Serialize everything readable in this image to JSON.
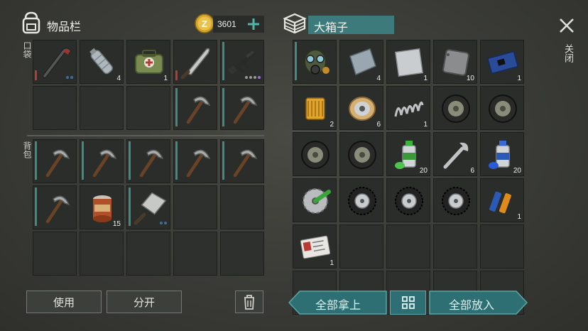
{
  "inventory": {
    "title": "物品栏",
    "coins": "3601",
    "pocket_label": "口袋",
    "backpack_label": "背包",
    "pocket_slots": [
      {
        "icon": "crowbar-icon",
        "count": "",
        "dur": "red",
        "dots": [
          "#3b6e9a",
          "#3b6e9a"
        ]
      },
      {
        "icon": "bottle-icon",
        "count": "4",
        "dur": "",
        "dots": []
      },
      {
        "icon": "medkit-bag-icon",
        "count": "1",
        "dur": "",
        "dots": []
      },
      {
        "icon": "machete-icon",
        "count": "",
        "dur": "red",
        "dots": []
      },
      {
        "icon": "rifle-icon",
        "count": "",
        "dur": "teal",
        "dots": [
          "#999",
          "#999",
          "#999",
          "#9a6bd0"
        ]
      },
      {
        "icon": "",
        "count": "",
        "dur": "",
        "dots": []
      },
      {
        "icon": "",
        "count": "",
        "dur": "",
        "dots": []
      },
      {
        "icon": "",
        "count": "",
        "dur": "",
        "dots": []
      },
      {
        "icon": "pickaxe-icon",
        "count": "",
        "dur": "teal",
        "dots": []
      },
      {
        "icon": "pickaxe-icon",
        "count": "",
        "dur": "teal",
        "dots": []
      }
    ],
    "backpack_slots": [
      {
        "icon": "pickaxe-icon",
        "count": "",
        "dur": "teal",
        "dots": []
      },
      {
        "icon": "pickaxe-icon",
        "count": "",
        "dur": "teal",
        "dots": []
      },
      {
        "icon": "pickaxe-icon",
        "count": "",
        "dur": "teal",
        "dots": []
      },
      {
        "icon": "pickaxe-icon",
        "count": "",
        "dur": "teal",
        "dots": []
      },
      {
        "icon": "pickaxe-icon",
        "count": "",
        "dur": "teal",
        "dots": []
      },
      {
        "icon": "pickaxe-icon",
        "count": "",
        "dur": "teal",
        "dots": []
      },
      {
        "icon": "can-icon",
        "count": "15",
        "dur": "",
        "dots": []
      },
      {
        "icon": "cleaver-icon",
        "count": "",
        "dur": "teal",
        "dots": [
          "#3b6e9a",
          "#3b6e9a"
        ]
      },
      {
        "icon": "",
        "count": "",
        "dur": "",
        "dots": []
      },
      {
        "icon": "",
        "count": "",
        "dur": "",
        "dots": []
      },
      {
        "icon": "",
        "count": "",
        "dur": "",
        "dots": []
      },
      {
        "icon": "",
        "count": "",
        "dur": "",
        "dots": []
      },
      {
        "icon": "",
        "count": "",
        "dur": "",
        "dots": []
      },
      {
        "icon": "",
        "count": "",
        "dur": "",
        "dots": []
      },
      {
        "icon": "",
        "count": "",
        "dur": "",
        "dots": []
      }
    ],
    "use_label": "使用",
    "split_label": "分开"
  },
  "box": {
    "title": "大箱子",
    "close_label": "关闭",
    "slots": [
      {
        "icon": "gas-mask-icon",
        "count": "",
        "dur": "teal"
      },
      {
        "icon": "metal-plate-icon",
        "count": "4",
        "dur": ""
      },
      {
        "icon": "steel-sheet-icon",
        "count": "1",
        "dur": ""
      },
      {
        "icon": "iron-plate-icon",
        "count": "10",
        "dur": ""
      },
      {
        "icon": "circuit-board-icon",
        "count": "1",
        "dur": ""
      },
      {
        "icon": "oil-filter-icon",
        "count": "2",
        "dur": ""
      },
      {
        "icon": "wire-spool-icon",
        "count": "6",
        "dur": ""
      },
      {
        "icon": "spring-icon",
        "count": "1",
        "dur": ""
      },
      {
        "icon": "wheel-icon",
        "count": "",
        "dur": ""
      },
      {
        "icon": "wheel-icon",
        "count": "",
        "dur": ""
      },
      {
        "icon": "wheel-icon",
        "count": "",
        "dur": ""
      },
      {
        "icon": "wheel-icon",
        "count": "",
        "dur": ""
      },
      {
        "icon": "spray-can-green-icon",
        "count": "20",
        "dur": ""
      },
      {
        "icon": "wrench-icon",
        "count": "6",
        "dur": ""
      },
      {
        "icon": "spray-can-blue-icon",
        "count": "20",
        "dur": ""
      },
      {
        "icon": "saw-blade-icon",
        "count": "",
        "dur": ""
      },
      {
        "icon": "tire-icon",
        "count": "",
        "dur": ""
      },
      {
        "icon": "tire-icon",
        "count": "",
        "dur": ""
      },
      {
        "icon": "tire-icon",
        "count": "",
        "dur": ""
      },
      {
        "icon": "batteries-icon",
        "count": "1",
        "dur": ""
      },
      {
        "icon": "id-card-icon",
        "count": "1",
        "dur": ""
      },
      {
        "icon": "",
        "count": "",
        "dur": ""
      },
      {
        "icon": "",
        "count": "",
        "dur": ""
      },
      {
        "icon": "",
        "count": "",
        "dur": ""
      },
      {
        "icon": "",
        "count": "",
        "dur": ""
      },
      {
        "icon": "",
        "count": "",
        "dur": ""
      },
      {
        "icon": "",
        "count": "",
        "dur": ""
      },
      {
        "icon": "",
        "count": "",
        "dur": ""
      },
      {
        "icon": "",
        "count": "",
        "dur": ""
      },
      {
        "icon": "",
        "count": "",
        "dur": ""
      }
    ],
    "take_all_label": "全部拿上",
    "put_all_label": "全部放入"
  },
  "colors": {
    "accent": "#2d6f73",
    "durability_teal": "#3e8a85",
    "durability_red": "#b83a33"
  }
}
